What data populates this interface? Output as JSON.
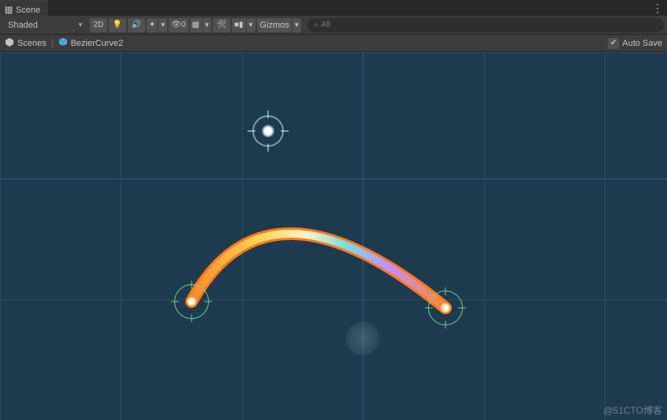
{
  "tab": {
    "title": "Scene"
  },
  "toolbar": {
    "render_mode": "Shaded",
    "btn_2d": "2D",
    "skybox_count": "0",
    "gizmos_label": "Gizmos",
    "search_placeholder": "All"
  },
  "breadcrumb": {
    "root": "Scenes",
    "current": "BezierCurve2",
    "autosave_label": "Auto Save",
    "autosave_checked": true
  },
  "watermark": "@51CTO博客"
}
